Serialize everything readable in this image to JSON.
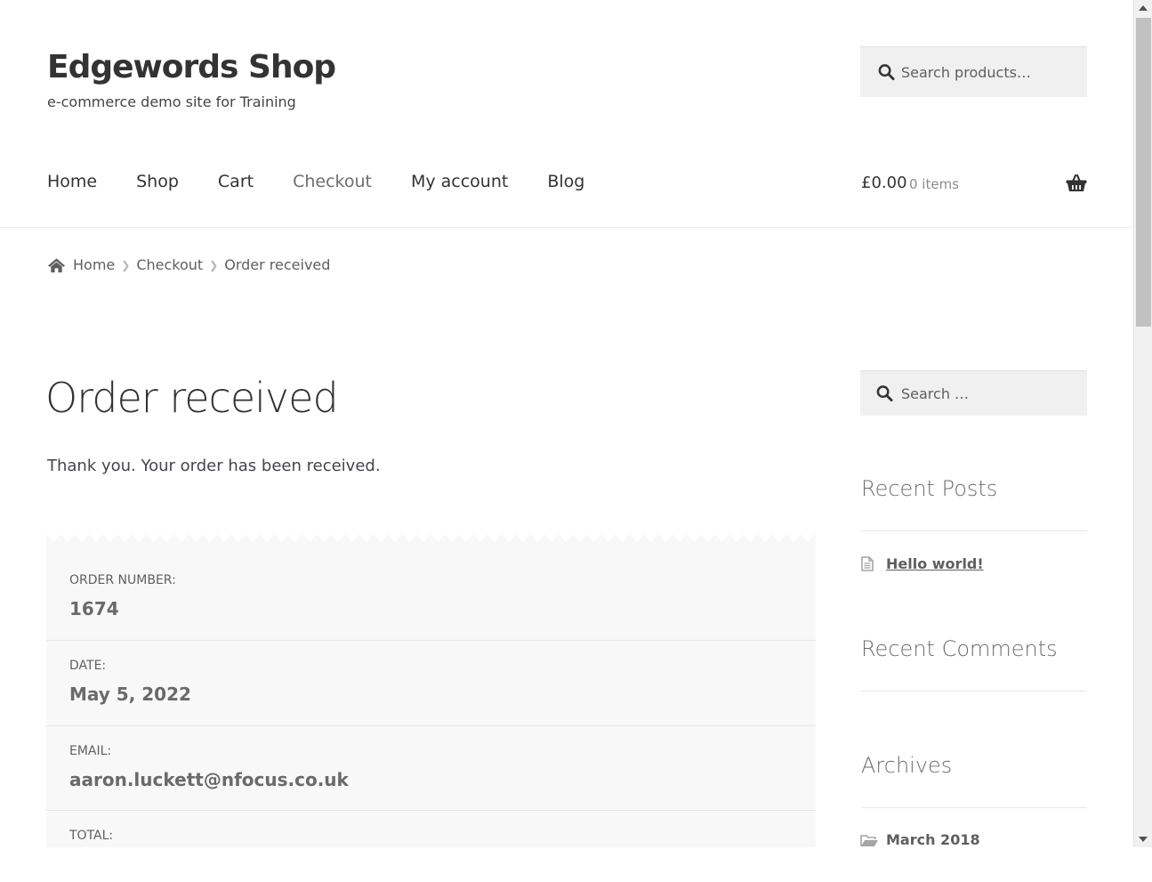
{
  "site": {
    "title": "Edgewords Shop",
    "description": "e-commerce demo site for Training"
  },
  "header_search": {
    "placeholder": "Search products…"
  },
  "nav": {
    "items": [
      {
        "label": "Home"
      },
      {
        "label": "Shop"
      },
      {
        "label": "Cart"
      },
      {
        "label": "Checkout",
        "active": true
      },
      {
        "label": "My account"
      },
      {
        "label": "Blog"
      }
    ]
  },
  "cart": {
    "amount": "£0.00",
    "items": "0 items"
  },
  "breadcrumb": {
    "home": "Home",
    "checkout": "Checkout",
    "current": "Order received"
  },
  "main": {
    "title": "Order received",
    "thanks": "Thank you. Your order has been received.",
    "order": {
      "number_label": "Order number:",
      "number": "1674",
      "date_label": "Date:",
      "date": "May 5, 2022",
      "email_label": "Email:",
      "email": "aaron.luckett@nfocus.co.uk",
      "total_label": "Total:"
    }
  },
  "sidebar": {
    "search_placeholder": "Search …",
    "recent_posts_title": "Recent Posts",
    "recent_posts": [
      "Hello world!"
    ],
    "recent_comments_title": "Recent Comments",
    "archives_title": "Archives",
    "archives": [
      "March 2018"
    ]
  },
  "colors": {
    "text": "#43454b",
    "heading": "#333333",
    "order_box_bg": "#f8f8f8",
    "search_bg": "#f0f0f0"
  }
}
